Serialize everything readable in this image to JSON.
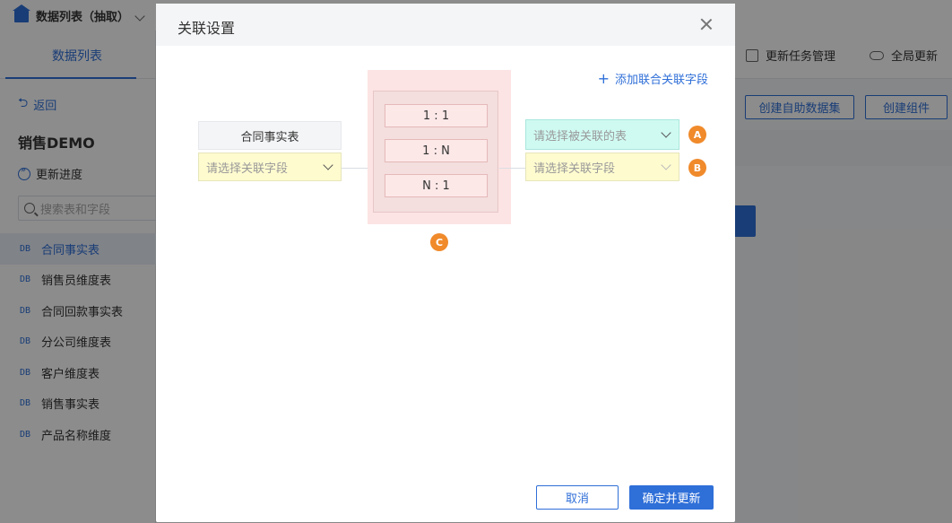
{
  "app": {
    "title": "数据列表（抽取）",
    "left_tab": "数据列表",
    "back_label": "返回",
    "package_name": "销售DEMO",
    "update_progress": "更新进度",
    "search_placeholder": "搜索表和字段",
    "tables": [
      {
        "icon": "DB",
        "label": "合同事实表",
        "active": true
      },
      {
        "icon": "DB",
        "label": "销售员维度表"
      },
      {
        "icon": "DB",
        "label": "合同回款事实表"
      },
      {
        "icon": "DB",
        "label": "分公司维度表"
      },
      {
        "icon": "DB",
        "label": "客户维度表"
      },
      {
        "icon": "DB",
        "label": "销售事实表"
      },
      {
        "icon": "DB",
        "label": "产品名称维度"
      }
    ],
    "right_bar": {
      "task_manage": "更新任务管理",
      "global_update": "全局更新",
      "create_dataset": "创建自助数据集",
      "create_component": "创建组件"
    }
  },
  "modal": {
    "title": "关联设置",
    "add_link": "添加联合关联字段",
    "left_table": "合同事实表",
    "left_field_placeholder": "请选择关联字段",
    "ratios": [
      "1 : 1",
      "1 : N",
      "N : 1"
    ],
    "right_table_placeholder": "请选择被关联的表",
    "right_field_placeholder": "请选择关联字段",
    "markers": {
      "a": "A",
      "b": "B",
      "c": "C"
    },
    "cancel": "取消",
    "confirm": "确定并更新"
  },
  "colors": {
    "accent": "#2f6fd8",
    "marker": "#f08a2b",
    "highlight_yellow": "#fefbcf",
    "highlight_cyan": "#cffaf2",
    "highlight_pink": "#fde4e4"
  }
}
